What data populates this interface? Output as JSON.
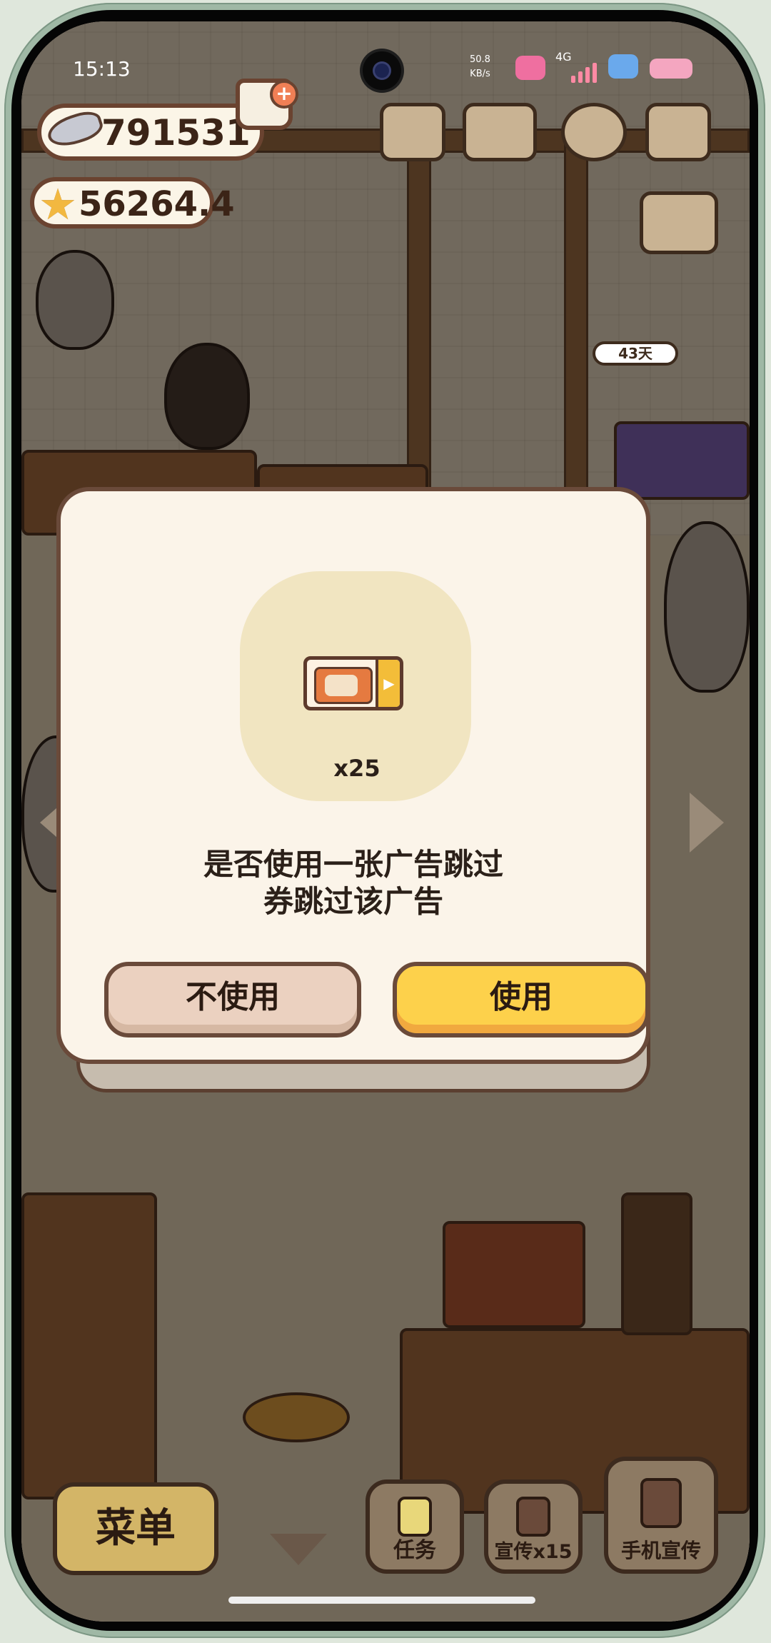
{
  "status_bar": {
    "time": "15:13",
    "net_speed_value": "50.8",
    "net_speed_unit": "KB/s",
    "network": "4G"
  },
  "hud": {
    "fish_currency": "791531",
    "star_currency": "56264.4",
    "days_badge": "43天"
  },
  "dialog": {
    "item_count": "x25",
    "message_line1": "是否使用一张广告跳过",
    "message_line2": "券跳过该广告",
    "cancel_label": "不使用",
    "confirm_label": "使用"
  },
  "bottom_bar": {
    "menu_label": "菜单",
    "task_label": "任务",
    "promote_label": "宣传x15",
    "phone_promote_label": "手机宣传"
  },
  "icons": {
    "fish": "fish-icon",
    "star": "star-icon",
    "cart": "cart-add-icon",
    "ticket": "ad-skip-ticket-icon"
  },
  "colors": {
    "dialog_bg": "#fbf4e9",
    "confirm_button": "#fdd14b",
    "cancel_button": "#ebd1c0",
    "border": "#6a4a3a"
  }
}
